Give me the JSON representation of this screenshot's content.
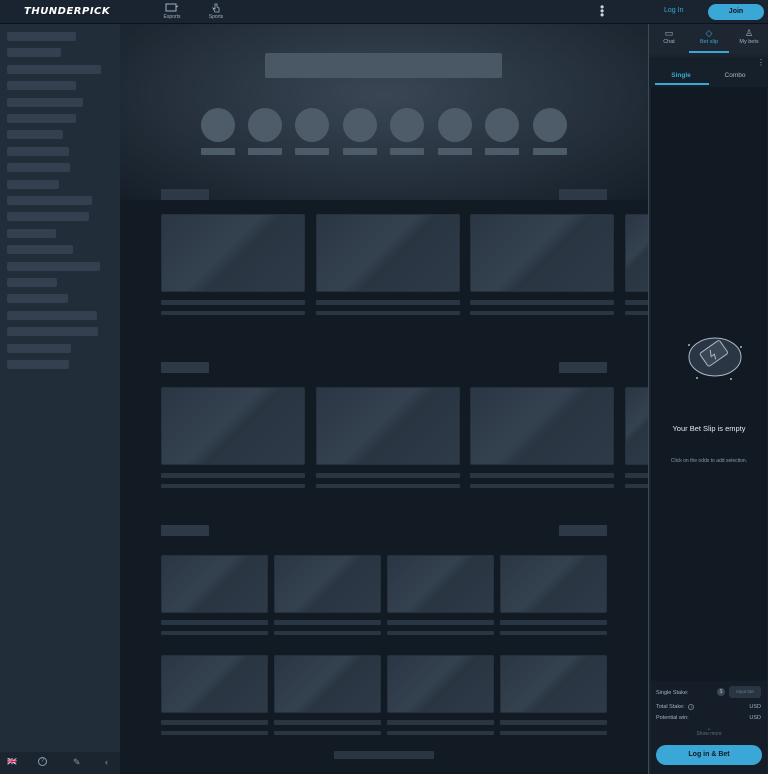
{
  "header": {
    "logo": "THUNDERPICK",
    "nav": [
      {
        "label": "Esports",
        "icon": "monitor-icon"
      },
      {
        "label": "Sports",
        "icon": "hand-pointer-icon"
      }
    ],
    "menu_glyph": "⋮",
    "login_label": "Log In",
    "join_label": "Join"
  },
  "sidebar": {
    "footer": {
      "flag": "🇬🇧",
      "help": "?",
      "edit": "✎",
      "collapse": "‹"
    }
  },
  "betslip": {
    "tabs": [
      {
        "label": "Chat",
        "icon": "chat-icon",
        "active": false
      },
      {
        "label": "Bet slip",
        "icon": "ticket-icon",
        "active": true
      },
      {
        "label": "My bets",
        "icon": "user-bets-icon",
        "active": false
      }
    ],
    "subtabs": [
      {
        "label": "Single",
        "active": true
      },
      {
        "label": "Combo",
        "active": false
      }
    ],
    "empty_title": "Your Bet Slip is empty",
    "empty_subtitle": "Click on the odds to add selection.",
    "stake": {
      "single_stake_label": "Single Stake:",
      "single_stake_placeholder": "Input bet",
      "total_stake_label": "Total Stake:",
      "total_stake_currency": "USD",
      "potential_win_label": "Potential win:",
      "potential_win_currency": "USD",
      "show_more": "Show more",
      "cta_label": "Log in & Bet"
    },
    "accent_color": "#3aa7d6"
  }
}
